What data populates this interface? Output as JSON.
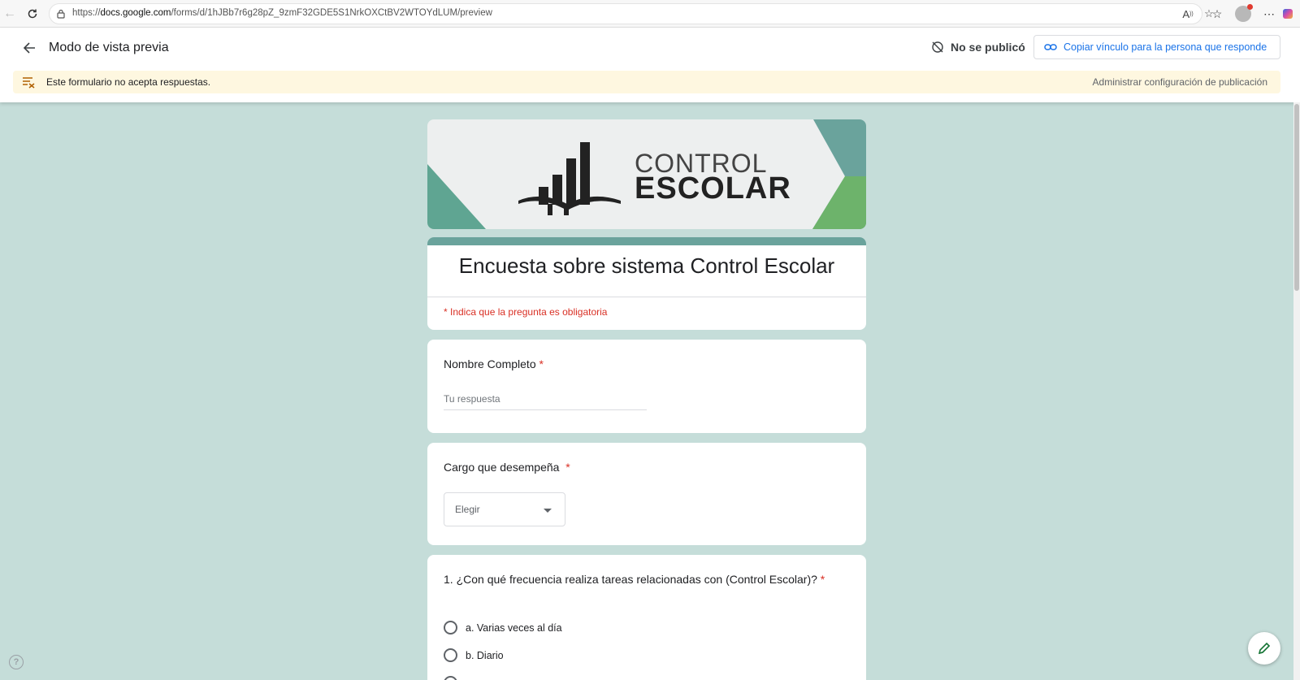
{
  "browser": {
    "url_prefix": "https://",
    "url_domain": "docs.google.com",
    "url_path": "/forms/d/1hJBb7r6g28pZ_9zmF32GDE5S1NrkOXCtBV2WTOYdLUM/preview"
  },
  "header": {
    "title": "Modo de vista previa",
    "status": "No se publicó",
    "copy_link_label": "Copiar vínculo para la persona que responde"
  },
  "banner_notice": {
    "message": "Este formulario no acepta respuestas.",
    "manage_link": "Administrar configuración de publicación"
  },
  "logo": {
    "line1": "CONTROL",
    "line2": "ESCOLAR"
  },
  "form": {
    "title": "Encuesta sobre sistema Control Escolar",
    "required_note": "* Indica que la pregunta es obligatoria",
    "questions": [
      {
        "label": "Nombre Completo",
        "required_mark": "*",
        "placeholder": "Tu respuesta"
      },
      {
        "label": "Cargo que desempeña",
        "required_mark": "*",
        "select_value": "Elegir"
      },
      {
        "label": "1. ¿Con qué frecuencia realiza tareas relacionadas con (Control Escolar)?",
        "required_mark": "*",
        "options": [
          "a. Varias veces al día",
          "b. Diario"
        ]
      }
    ]
  },
  "colors": {
    "background": "#c5ddd9",
    "accent": "#6aa39c",
    "required": "#d93025",
    "link": "#1a73e8",
    "notice": "#fef7e0"
  }
}
